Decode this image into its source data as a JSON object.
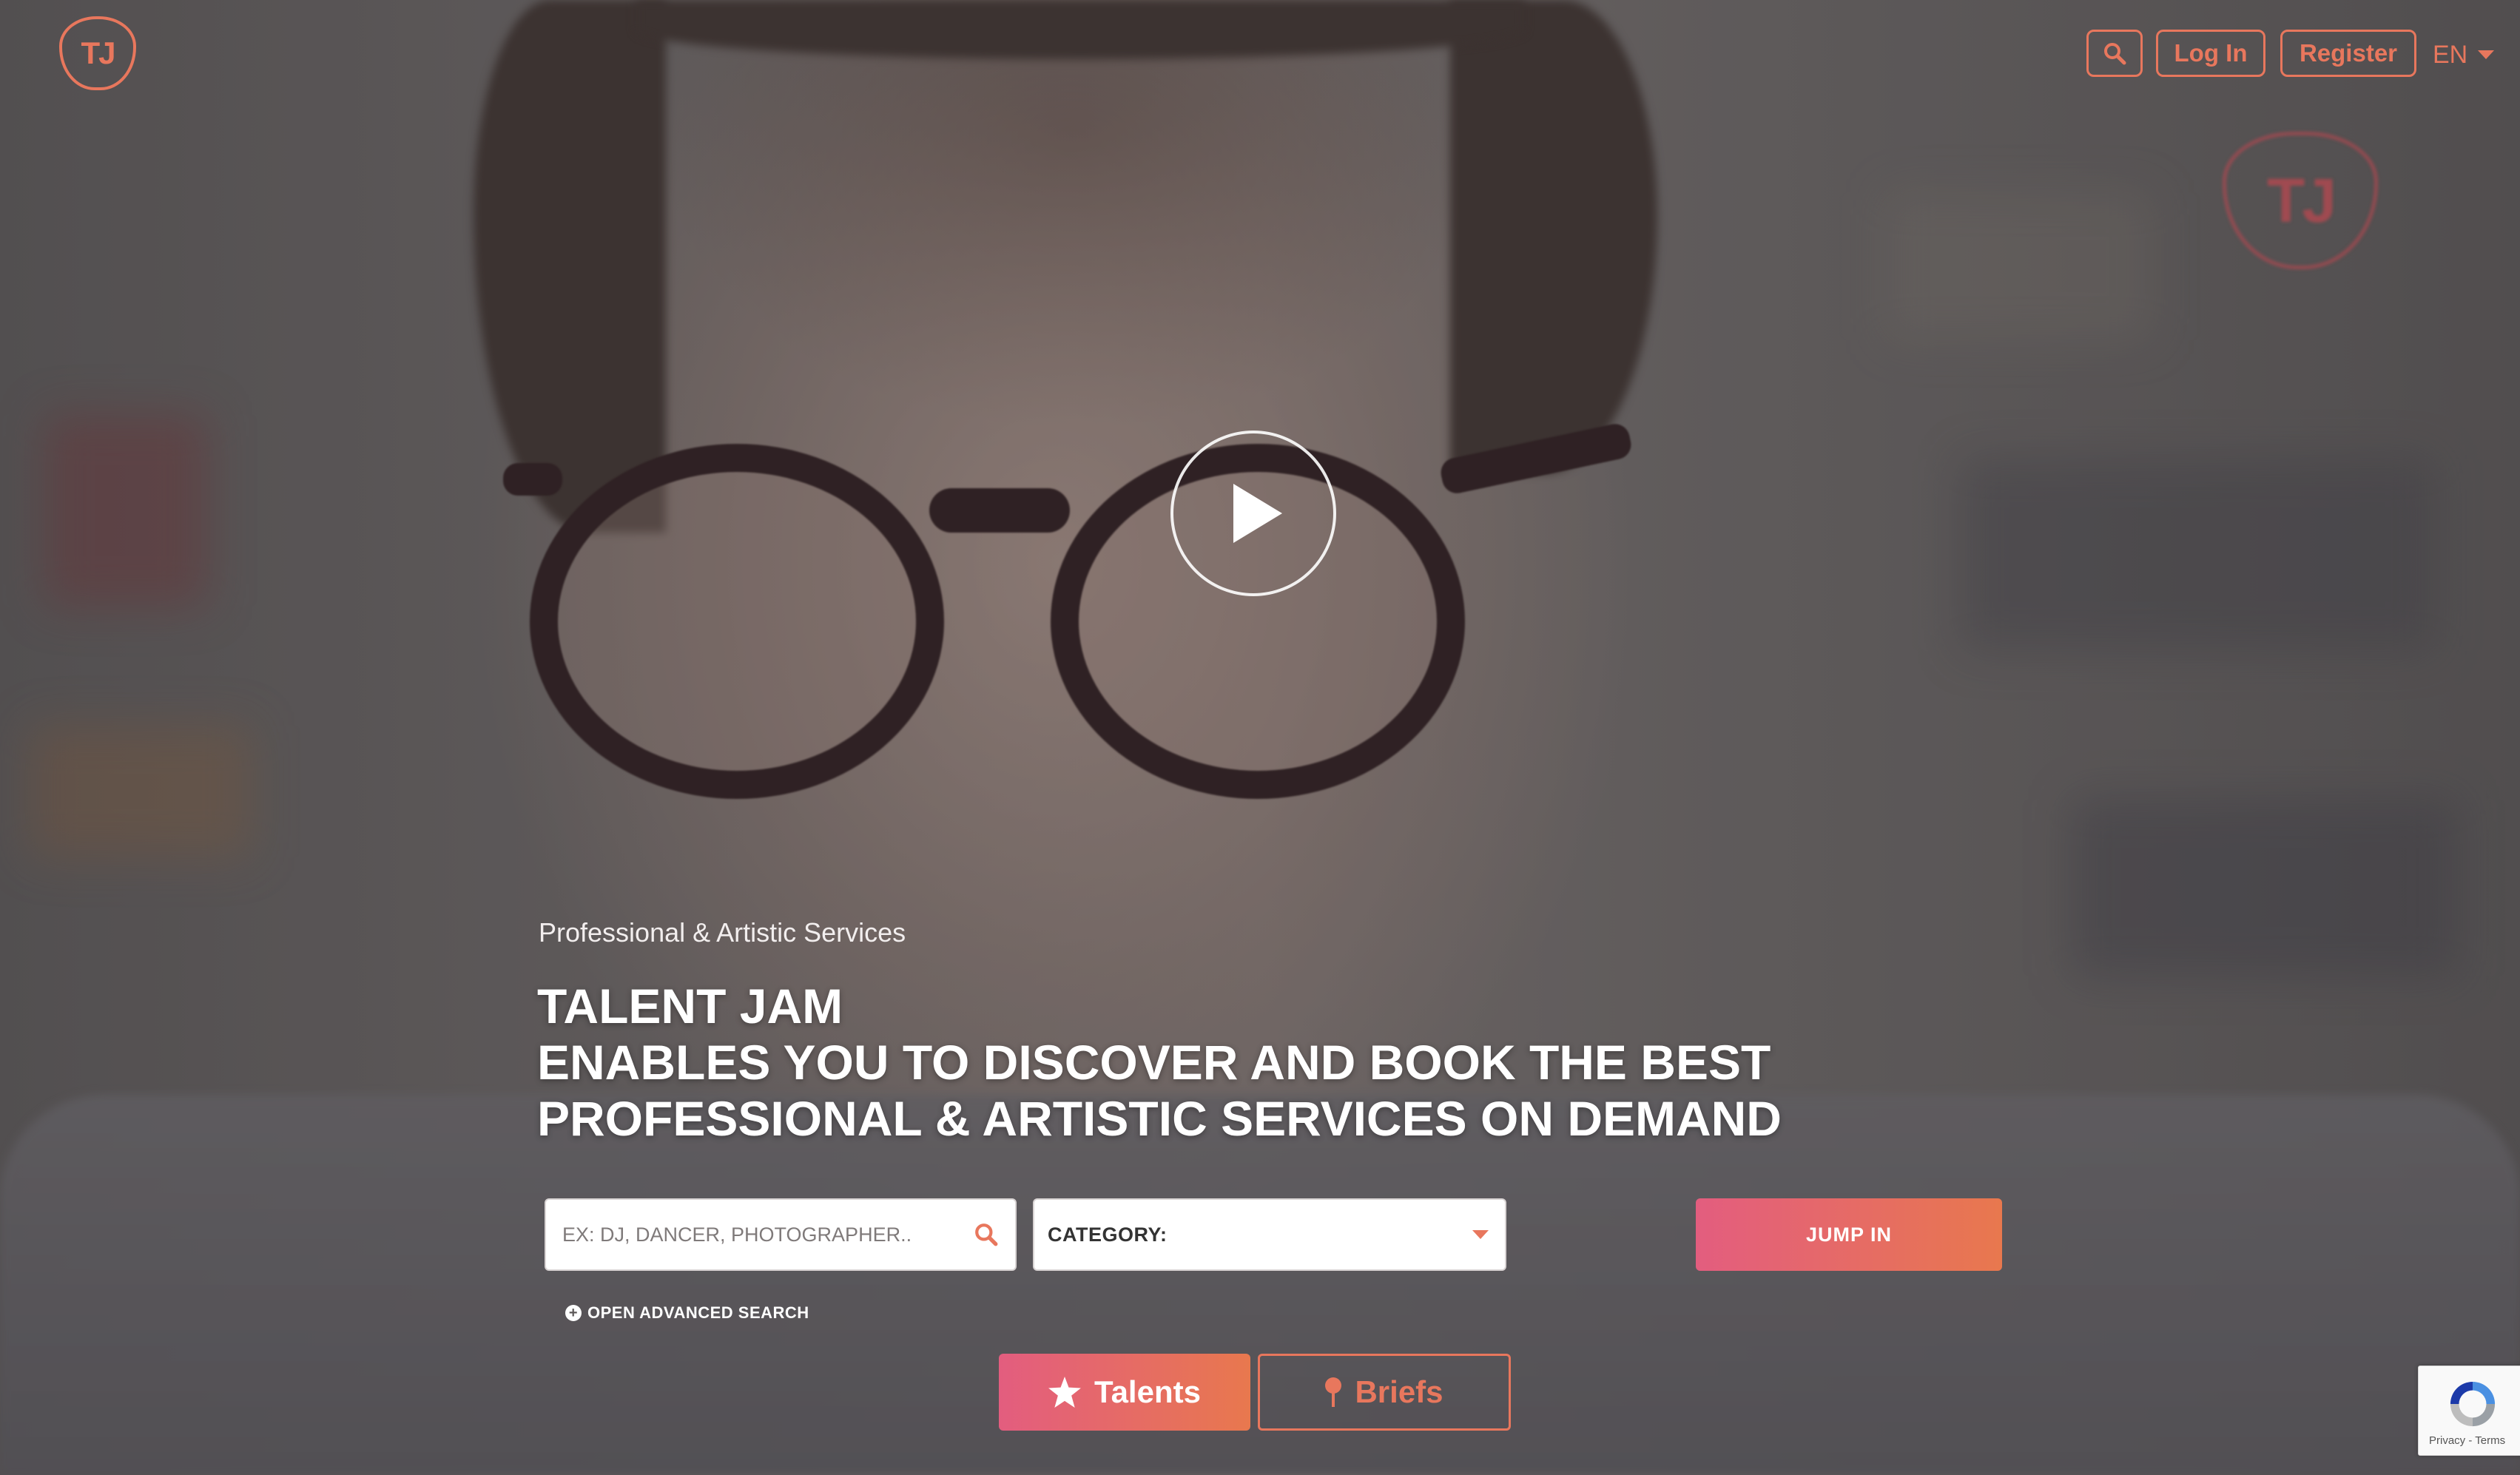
{
  "header": {
    "logo_text": "TJ",
    "watermark_text": "TJ",
    "search_icon": "search-icon",
    "login_label": "Log In",
    "register_label": "Register",
    "language": "EN"
  },
  "hero": {
    "subtitle": "Professional & Artistic Services",
    "headline_line1": "TALENT JAM",
    "headline_line2": "ENABLES YOU TO DISCOVER AND BOOK THE BEST",
    "headline_line3": "PROFESSIONAL & ARTISTIC SERVICES ON DEMAND",
    "play_icon": "play-icon"
  },
  "search": {
    "placeholder": "EX: DJ, DANCER, PHOTOGRAPHER..",
    "category_label": "CATEGORY:",
    "submit_label": "JUMP IN",
    "advanced_label": "OPEN ADVANCED SEARCH"
  },
  "tabs": {
    "talents_label": "Talents",
    "briefs_label": "Briefs"
  },
  "recaptcha": {
    "links": "Privacy - Terms"
  },
  "colors": {
    "accent": "#e8775d",
    "gradient_start": "#e35d7f",
    "gradient_end": "#e8784e"
  }
}
